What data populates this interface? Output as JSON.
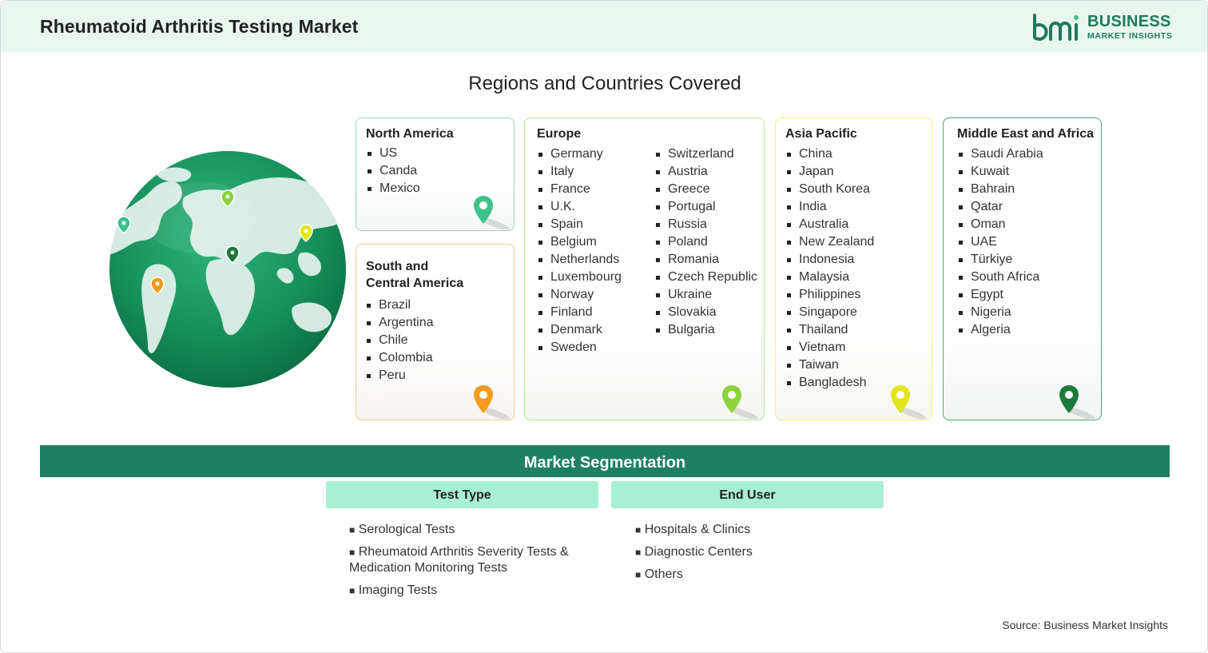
{
  "header": {
    "title": "Rheumatoid Arthritis Testing Market",
    "logo_line1": "BUSINESS",
    "logo_line2": "MARKET INSIGHTS",
    "logo_mark": "bmi"
  },
  "regions_title": "Regions and Countries Covered",
  "regions": {
    "north_america": {
      "title": "North America",
      "items": [
        "US",
        "Canda",
        "Mexico"
      ],
      "color": "#3fc28a"
    },
    "south_america": {
      "title_line1": "South and",
      "title_line2": "Central America",
      "items": [
        "Brazil",
        "Argentina",
        "Chile",
        "Colombia",
        "Peru"
      ],
      "color": "#f39b1f"
    },
    "europe": {
      "title": "Europe",
      "col1": [
        "Germany",
        "Italy",
        "France",
        "U.K.",
        "Spain",
        "Belgium",
        "Netherlands",
        "Luxembourg",
        "Norway",
        "Finland",
        "Denmark",
        "Sweden"
      ],
      "col2": [
        "Switzerland",
        "Austria",
        "Greece",
        "Portugal",
        "Russia",
        "Poland",
        "Romania",
        "Czech Republic",
        "Ukraine",
        "Slovakia",
        "Bulgaria"
      ],
      "color": "#8cd23c"
    },
    "asia_pacific": {
      "title": "Asia Pacific",
      "items": [
        "China",
        "Japan",
        "South Korea",
        "India",
        "Australia",
        "New Zealand",
        "Indonesia",
        "Malaysia",
        "Philippines",
        "Singapore",
        "Thailand",
        "Vietnam",
        "Taiwan",
        "Bangladesh"
      ],
      "color": "#e3e51c"
    },
    "mea": {
      "title": "Middle East and Africa",
      "items": [
        "Saudi Arabia",
        "Kuwait",
        "Bahrain",
        "Qatar",
        "Oman",
        "UAE",
        "Türkiye",
        "South Africa",
        "Egypt",
        "Nigeria",
        "Algeria"
      ],
      "color": "#1a7a3a"
    }
  },
  "segmentation": {
    "title": "Market Segmentation",
    "test_type": {
      "title": "Test Type",
      "items": [
        "Serological Tests",
        "Rheumatoid Arthritis Severity Tests &",
        "Medication Monitoring Tests",
        "Imaging Tests"
      ]
    },
    "end_user": {
      "title": "End User",
      "items": [
        "Hospitals & Clinics",
        "Diagnostic Centers",
        "Others"
      ]
    },
    "bullet": "■"
  },
  "source": "Source: Business Market Insights",
  "colors": {
    "header_bg": "#e9f6ef",
    "brand_green": "#1e8062",
    "segment_head_bg": "#a8f0d4"
  }
}
